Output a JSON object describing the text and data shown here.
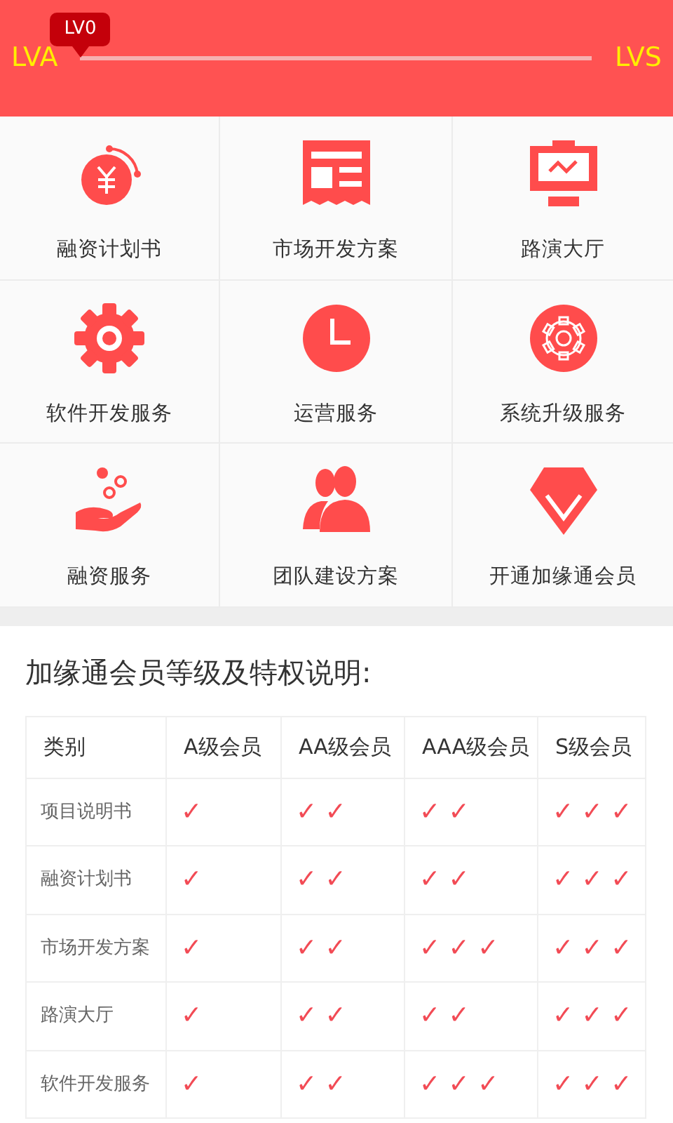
{
  "level_bar": {
    "start_label": "LVA",
    "end_label": "LVS",
    "tooltip": "LV0"
  },
  "services": [
    {
      "kind": "yen",
      "label": "融资计划书"
    },
    {
      "kind": "news",
      "label": "市场开发方案"
    },
    {
      "kind": "monitor",
      "label": "路演大厅"
    },
    {
      "kind": "gear",
      "label": "软件开发服务"
    },
    {
      "kind": "clock",
      "label": "运营服务"
    },
    {
      "kind": "gearcircle",
      "label": "系统升级服务"
    },
    {
      "kind": "hand",
      "label": "融资服务"
    },
    {
      "kind": "people",
      "label": "团队建设方案"
    },
    {
      "kind": "diamond",
      "label": "开通加缘通会员"
    }
  ],
  "membership": {
    "title": "加缘通会员等级及特权说明:",
    "columns": [
      "类别",
      "A级会员",
      "AA级会员",
      "AAA级会员",
      "S级会员"
    ],
    "rows": [
      [
        "项目说明书",
        "✓",
        "✓ ✓",
        "✓ ✓",
        "✓ ✓ ✓"
      ],
      [
        "融资计划书",
        "✓",
        "✓ ✓",
        "✓ ✓",
        "✓ ✓ ✓"
      ],
      [
        "市场开发方案",
        "✓",
        "✓ ✓",
        "✓ ✓ ✓",
        "✓ ✓ ✓"
      ],
      [
        "路演大厅",
        "✓",
        "✓ ✓",
        "✓ ✓",
        "✓ ✓ ✓"
      ],
      [
        "软件开发服务",
        "✓",
        "✓ ✓",
        "✓ ✓ ✓",
        "✓ ✓ ✓"
      ]
    ]
  }
}
